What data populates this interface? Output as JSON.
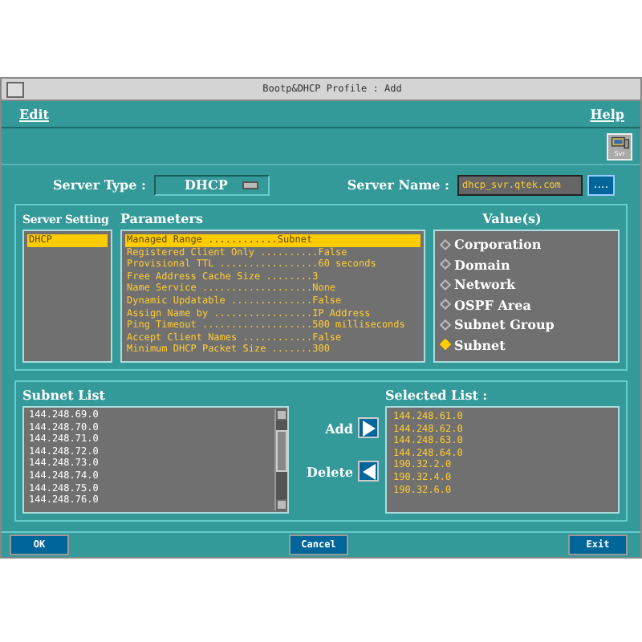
{
  "window": {
    "title": "Bootp&DHCP Profile : Add"
  },
  "menu": [
    "Edit",
    "Help"
  ],
  "toolbar": {
    "button": "Svr"
  },
  "server_type": {
    "label": "Server Type :",
    "value": "DHCP"
  },
  "server_name": {
    "label": "Server Name :",
    "value": "dhcp_svr.qtek.com",
    "browse": "...."
  },
  "server_setting": {
    "title": "Server Setting",
    "items": [
      {
        "label": "DHCP",
        "selected": true
      }
    ]
  },
  "parameters": {
    "title": "Parameters",
    "items": [
      {
        "label": "Managed Range ............Subnet",
        "selected": true
      },
      {
        "label": "Registered Client Only ..........False",
        "selected": false
      },
      {
        "label": "Provisional TTL .................60 seconds",
        "selected": false
      },
      {
        "label": "Free Address Cache Size ........3",
        "selected": false
      },
      {
        "label": "Name Service ...................None",
        "selected": false
      },
      {
        "label": "Dynamic Updatable ..............False",
        "selected": false
      },
      {
        "label": "Assign Name by .................IP Address",
        "selected": false
      },
      {
        "label": "Ping Timeout ...................500 milliseconds",
        "selected": false
      },
      {
        "label": "Accept Client Names ............False",
        "selected": false
      },
      {
        "label": "Minimum DHCP Packet Size .......300",
        "selected": false
      }
    ]
  },
  "values": {
    "title": "Value(s)",
    "items": [
      {
        "label": "Corporation",
        "selected": false
      },
      {
        "label": "Domain",
        "selected": false
      },
      {
        "label": "Network",
        "selected": false
      },
      {
        "label": "OSPF Area",
        "selected": false
      },
      {
        "label": "Subnet Group",
        "selected": false
      },
      {
        "label": "Subnet",
        "selected": true
      }
    ]
  },
  "subnet_list": {
    "title": "Subnet List",
    "items": [
      "144.248.69.0",
      "144.248.70.0",
      "144.248.71.0",
      "144.248.72.0",
      "144.248.73.0",
      "144.248.74.0",
      "144.248.75.0",
      "144.248.76.0"
    ]
  },
  "add_button": {
    "label": "Add"
  },
  "delete_button": {
    "label": "Delete"
  },
  "selected_list": {
    "title": "Selected List :",
    "items": [
      "144.248.61.0",
      "144.248.62.0",
      "144.248.63.0",
      "144.248.64.0",
      "190.32.2.0",
      "190.32.4.0",
      "190.32.6.0"
    ]
  },
  "buttons": [
    "OK",
    "Cancel",
    "Exit"
  ]
}
